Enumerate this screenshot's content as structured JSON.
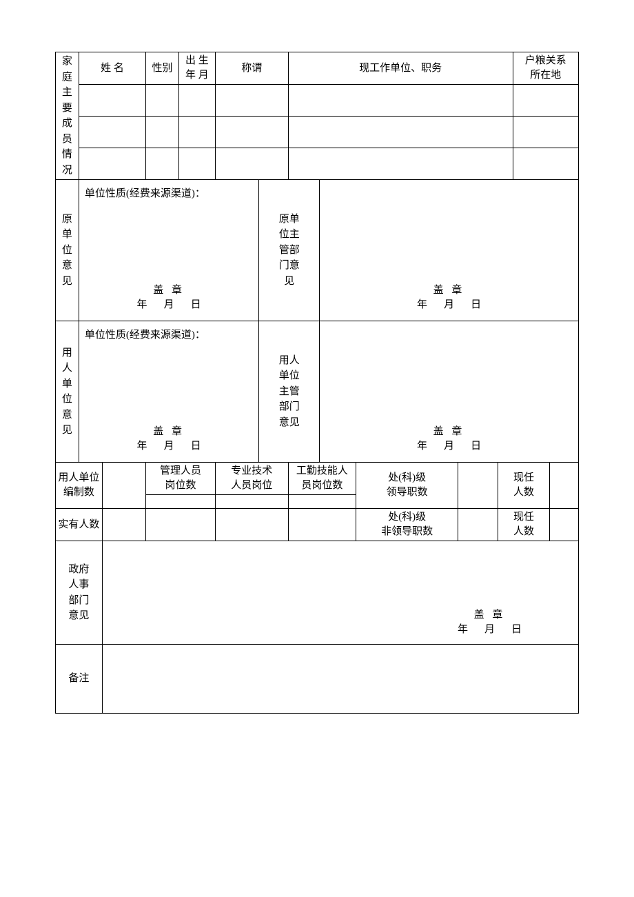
{
  "family": {
    "title": "家庭主要成员情况",
    "headers": {
      "name": "姓   名",
      "gender": "性别",
      "birth": "出 生\n年 月",
      "relation": "称谓",
      "workunit": "现工作单位、职务",
      "hukou": "户粮关系所在地"
    },
    "rows": [
      {
        "name": "",
        "gender": "",
        "birth": "",
        "relation": "",
        "workunit": "",
        "hukou": ""
      },
      {
        "name": "",
        "gender": "",
        "birth": "",
        "relation": "",
        "workunit": "",
        "hukou": ""
      },
      {
        "name": "",
        "gender": "",
        "birth": "",
        "relation": "",
        "workunit": "",
        "hukou": ""
      }
    ]
  },
  "orig_unit": {
    "label": "原单位意见",
    "nature": "单位性质(经费来源渠道)：",
    "stamp": "盖 章",
    "y": "年",
    "m": "月",
    "d": "日"
  },
  "orig_sup": {
    "label": "原单位主管部门意见",
    "stamp": "盖 章",
    "y": "年",
    "m": "月",
    "d": "日"
  },
  "emp_unit": {
    "label": "用人单位意见",
    "nature": "单位性质(经费来源渠道)：",
    "stamp": "盖 章",
    "y": "年",
    "m": "月",
    "d": "日"
  },
  "emp_sup": {
    "label": "用人单位主管部门意见",
    "stamp": "盖 章",
    "y": "年",
    "m": "月",
    "d": "日"
  },
  "staff": {
    "bianzhi": "用人单位编制数",
    "mgmt": "管理人员岗位数",
    "tech": "专业技术人员岗位",
    "skill": "工勤技能人员岗位数",
    "chuke_lead": "处(科)级领导职数",
    "current1": "现任人数",
    "actual": "实有人数",
    "chuke_nonlead": "处(科)级非领导职数",
    "current2": "现任人数",
    "vals": {
      "bianzhi": "",
      "mgmt_h": "",
      "tech_h": "",
      "skill_h": "",
      "chuke_lead_n": "",
      "current1_n": "",
      "actual_n": "",
      "mgmt_a": "",
      "tech_a": "",
      "skill_a": "",
      "chuke_nonlead_n": "",
      "current2_n": ""
    }
  },
  "gov": {
    "label": "政府人事部门意见",
    "stamp": "盖 章",
    "y": "年",
    "m": "月",
    "d": "日"
  },
  "remark": {
    "label": "备注",
    "value": ""
  }
}
